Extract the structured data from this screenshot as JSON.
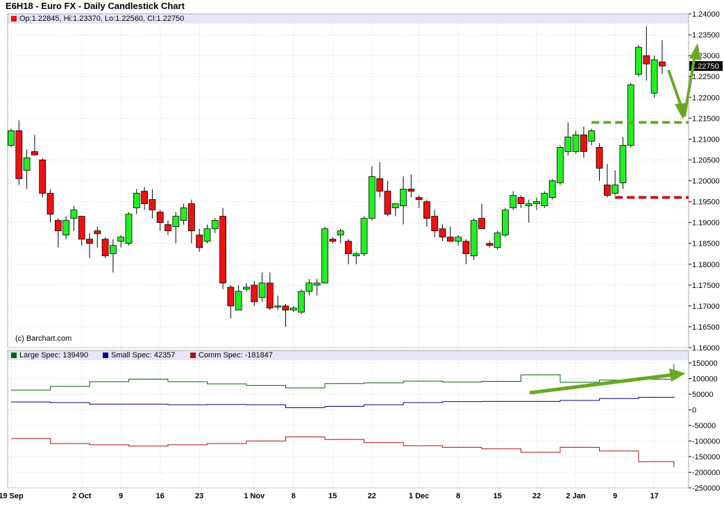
{
  "title": "E6H18 - Euro FX - Daily Candlestick Chart",
  "ohlc_label": "Op:1.22845, Hi:1.23370, Lo:1.22560, Cl:1.22750",
  "credit": "(c) Barchart.com",
  "last_price_label": "1.22750",
  "colors": {
    "up": "#22ee22",
    "down": "#ee1111",
    "large": "#006400",
    "small": "#000080",
    "comm": "#aa1111",
    "annot_green": "#66aa22",
    "annot_red": "#cc1111",
    "legend_bg": "#e6e6fa"
  },
  "chart_data": [
    {
      "type": "candlestick",
      "y_ticks": [
        "1.16000",
        "1.16500",
        "1.17000",
        "1.17500",
        "1.18000",
        "1.18500",
        "1.19000",
        "1.19500",
        "1.20000",
        "1.20500",
        "1.21000",
        "1.21500",
        "1.22000",
        "1.22500",
        "1.23000",
        "1.23500",
        "1.24000"
      ],
      "ylim": [
        1.16,
        1.24
      ],
      "x_ticks": [
        {
          "label": "19 Sep",
          "i": 0
        },
        {
          "label": "2 Oct",
          "i": 9
        },
        {
          "label": "9",
          "i": 14
        },
        {
          "label": "16",
          "i": 19
        },
        {
          "label": "23",
          "i": 24
        },
        {
          "label": "1 Nov",
          "i": 31
        },
        {
          "label": "8",
          "i": 36
        },
        {
          "label": "15",
          "i": 41
        },
        {
          "label": "22",
          "i": 46
        },
        {
          "label": "1 Dec",
          "i": 52
        },
        {
          "label": "8",
          "i": 57
        },
        {
          "label": "15",
          "i": 62
        },
        {
          "label": "22",
          "i": 67
        },
        {
          "label": "2 Jan",
          "i": 72
        },
        {
          "label": "9",
          "i": 77
        },
        {
          "label": "17",
          "i": 82
        }
      ],
      "candles": [
        [
          1.2085,
          1.2125,
          1.208,
          1.212
        ],
        [
          1.212,
          1.2145,
          1.199,
          1.2005
        ],
        [
          1.2025,
          1.2075,
          1.198,
          1.2055
        ],
        [
          1.207,
          1.211,
          1.206,
          1.2062
        ],
        [
          1.205,
          1.2055,
          1.196,
          1.197
        ],
        [
          1.197,
          1.198,
          1.19,
          1.192
        ],
        [
          1.1905,
          1.191,
          1.184,
          1.188
        ],
        [
          1.187,
          1.1915,
          1.186,
          1.1905
        ],
        [
          1.191,
          1.194,
          1.188,
          1.193
        ],
        [
          1.1915,
          1.1915,
          1.1845,
          1.186
        ],
        [
          1.186,
          1.1875,
          1.1815,
          1.185
        ],
        [
          1.188,
          1.189,
          1.184,
          1.1873
        ],
        [
          1.186,
          1.1865,
          1.1815,
          1.182
        ],
        [
          1.1825,
          1.186,
          1.178,
          1.1845
        ],
        [
          1.1855,
          1.187,
          1.184,
          1.1865
        ],
        [
          1.185,
          1.1925,
          1.1845,
          1.192
        ],
        [
          1.1935,
          1.198,
          1.192,
          1.197
        ],
        [
          1.1975,
          1.1985,
          1.193,
          1.1945
        ],
        [
          1.1955,
          1.198,
          1.191,
          1.193
        ],
        [
          1.1925,
          1.193,
          1.188,
          1.19
        ],
        [
          1.1895,
          1.1905,
          1.187,
          1.188
        ],
        [
          1.189,
          1.1925,
          1.185,
          1.1915
        ],
        [
          1.1905,
          1.1945,
          1.1895,
          1.1935
        ],
        [
          1.1945,
          1.1955,
          1.185,
          1.188
        ],
        [
          1.187,
          1.1885,
          1.183,
          1.184
        ],
        [
          1.1855,
          1.1895,
          1.185,
          1.1885
        ],
        [
          1.1885,
          1.191,
          1.1875,
          1.1905
        ],
        [
          1.1915,
          1.1935,
          1.174,
          1.1755
        ],
        [
          1.1745,
          1.175,
          1.167,
          1.17
        ],
        [
          1.169,
          1.175,
          1.169,
          1.1735
        ],
        [
          1.174,
          1.1755,
          1.1735,
          1.1745
        ],
        [
          1.175,
          1.176,
          1.17,
          1.171
        ],
        [
          1.172,
          1.178,
          1.171,
          1.1755
        ],
        [
          1.1755,
          1.178,
          1.169,
          1.1695
        ],
        [
          1.17,
          1.1725,
          1.169,
          1.17
        ],
        [
          1.17,
          1.1705,
          1.165,
          1.169
        ],
        [
          1.169,
          1.17,
          1.1685,
          1.1695
        ],
        [
          1.1685,
          1.174,
          1.168,
          1.1735
        ],
        [
          1.1735,
          1.1765,
          1.1725,
          1.1755
        ],
        [
          1.175,
          1.1765,
          1.1725,
          1.1755
        ],
        [
          1.1755,
          1.189,
          1.1755,
          1.1885
        ],
        [
          1.186,
          1.1865,
          1.185,
          1.1855
        ],
        [
          1.187,
          1.1885,
          1.185,
          1.188
        ],
        [
          1.1855,
          1.186,
          1.18,
          1.1825
        ],
        [
          1.182,
          1.183,
          1.18,
          1.1825
        ],
        [
          1.1825,
          1.1915,
          1.182,
          1.191
        ],
        [
          1.191,
          1.2035,
          1.1905,
          1.201
        ],
        [
          1.2005,
          1.2045,
          1.196,
          1.1975
        ],
        [
          1.1975,
          1.2,
          1.1915,
          1.192
        ],
        [
          1.1935,
          1.1945,
          1.1915,
          1.1945
        ],
        [
          1.194,
          1.201,
          1.1895,
          1.198
        ],
        [
          1.198,
          1.2015,
          1.196,
          1.1975
        ],
        [
          1.196,
          1.1965,
          1.1935,
          1.1955
        ],
        [
          1.195,
          1.1955,
          1.189,
          1.191
        ],
        [
          1.1915,
          1.193,
          1.1865,
          1.188
        ],
        [
          1.1885,
          1.1895,
          1.1855,
          1.1865
        ],
        [
          1.1865,
          1.189,
          1.1855,
          1.1855
        ],
        [
          1.1855,
          1.187,
          1.1845,
          1.1865
        ],
        [
          1.1855,
          1.186,
          1.18,
          1.1825
        ],
        [
          1.182,
          1.191,
          1.181,
          1.1905
        ],
        [
          1.191,
          1.1945,
          1.1895,
          1.1885
        ],
        [
          1.185,
          1.1855,
          1.184,
          1.1845
        ],
        [
          1.184,
          1.188,
          1.1835,
          1.1875
        ],
        [
          1.187,
          1.1935,
          1.1865,
          1.193
        ],
        [
          1.1935,
          1.1975,
          1.193,
          1.1965
        ],
        [
          1.196,
          1.1965,
          1.1935,
          1.1945
        ],
        [
          1.194,
          1.1955,
          1.19,
          1.1945
        ],
        [
          1.1945,
          1.196,
          1.193,
          1.195
        ],
        [
          1.194,
          1.1975,
          1.1935,
          1.197
        ],
        [
          1.196,
          1.2005,
          1.1955,
          1.2
        ],
        [
          1.1995,
          1.2085,
          1.199,
          1.208
        ],
        [
          1.207,
          1.214,
          1.206,
          1.2105
        ],
        [
          1.207,
          1.212,
          1.2065,
          1.211
        ],
        [
          1.211,
          1.213,
          1.2055,
          1.207
        ],
        [
          1.2095,
          1.2125,
          1.2085,
          1.212
        ],
        [
          1.208,
          1.209,
          1.2,
          1.203
        ],
        [
          1.199,
          1.204,
          1.196,
          1.1965
        ],
        [
          1.197,
          1.2025,
          1.1965,
          1.199
        ],
        [
          1.1995,
          1.2105,
          1.198,
          1.2085
        ],
        [
          1.2085,
          1.2235,
          1.208,
          1.223
        ],
        [
          1.2255,
          1.2325,
          1.225,
          1.232
        ],
        [
          1.23,
          1.237,
          1.224,
          1.228
        ],
        [
          1.221,
          1.23,
          1.22,
          1.229
        ],
        [
          1.2285,
          1.2337,
          1.2256,
          1.2275
        ]
      ]
    },
    {
      "type": "line",
      "ylim": [
        -250000,
        160000
      ],
      "y_ticks": [
        "150000",
        "100000",
        "50000",
        "0",
        "-50000",
        "-100000",
        "-150000",
        "-200000",
        "-250000"
      ],
      "series": [
        {
          "name": "Large Spec: 139490",
          "color": "#006400",
          "weeks": [
            63000,
            75000,
            90000,
            98000,
            90000,
            83000,
            78000,
            70000,
            84000,
            86000,
            92000,
            89000,
            91000,
            112000,
            88000,
            95000,
            98000,
            122000,
            147000,
            139490
          ]
        },
        {
          "name": "Small Spec: 42357",
          "color": "#000080",
          "weeks": [
            25000,
            23000,
            18000,
            18000,
            16000,
            17000,
            16000,
            7000,
            11000,
            16000,
            23000,
            26000,
            27000,
            27000,
            30000,
            36000,
            40000,
            38000,
            39000,
            42357
          ]
        },
        {
          "name": "Comm Spec: -181847",
          "color": "#aa1111",
          "weeks": [
            -92000,
            -108000,
            -112000,
            -116000,
            -112000,
            -108000,
            -100000,
            -87000,
            -95000,
            -105000,
            -115000,
            -120000,
            -125000,
            -136000,
            -120000,
            -132000,
            -166000,
            -174000,
            -184000,
            -181847
          ]
        }
      ]
    }
  ]
}
